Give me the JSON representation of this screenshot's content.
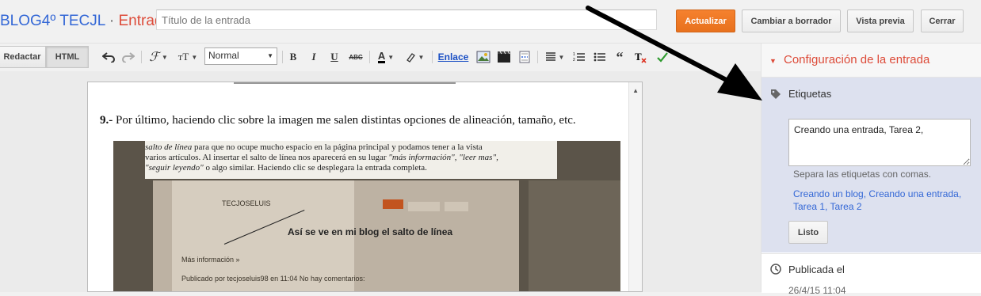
{
  "header": {
    "blog_name": "BLOG4º TECJL",
    "separator": "·",
    "page_label": "Entrada",
    "title_placeholder": "Título de la entrada",
    "buttons": {
      "update": "Actualizar",
      "draft": "Cambiar a borrador",
      "preview": "Vista previa",
      "close": "Cerrar"
    }
  },
  "toolbar": {
    "compose": "Redactar",
    "html": "HTML",
    "format": "Normal",
    "link": "Enlace"
  },
  "content": {
    "step_number": "9.-",
    "step_text": "Por último, haciendo clic sobre la imagen me salen distintas opciones de alineación, tamaño, etc.",
    "image": {
      "line1_italic": "salto de línea",
      "line1_rest": " para que no ocupe mucho espacio en la página principal y podamos tener a la vista",
      "line2_start": "varios artículos. Al insertar el salto de línea nos aparecerá en su lugar ",
      "line2_italic": "\"más información\", \"leer mas\",",
      "line3_italic": "\"seguir leyendo\"",
      "line3_rest": " o algo similar. Haciendo clic se desplegara la entrada completa.",
      "caption": "Así se ve en mi blog el salto de línea",
      "blog_name": "TECJOSELUIS",
      "more_info": "Más información »",
      "posted_by": "Publicado por tecjoseluis98 en 11:04     No hay comentarios:"
    }
  },
  "sidebar": {
    "settings_title": "Configuración de la entrada",
    "labels": {
      "title": "Etiquetas",
      "value": "Creando una entrada, Tarea 2,",
      "help": "Separa las etiquetas con comas.",
      "suggestions": "Creando un blog, Creando una entrada, Tarea 1, Tarea 2",
      "done": "Listo"
    },
    "published": {
      "title": "Publicada el",
      "date": "26/4/15 11:04"
    }
  },
  "colors": {
    "accent": "#dd4b39",
    "primary_button": "#f07b27",
    "link": "#3367d6",
    "labels_bg": "#dde1ef"
  }
}
